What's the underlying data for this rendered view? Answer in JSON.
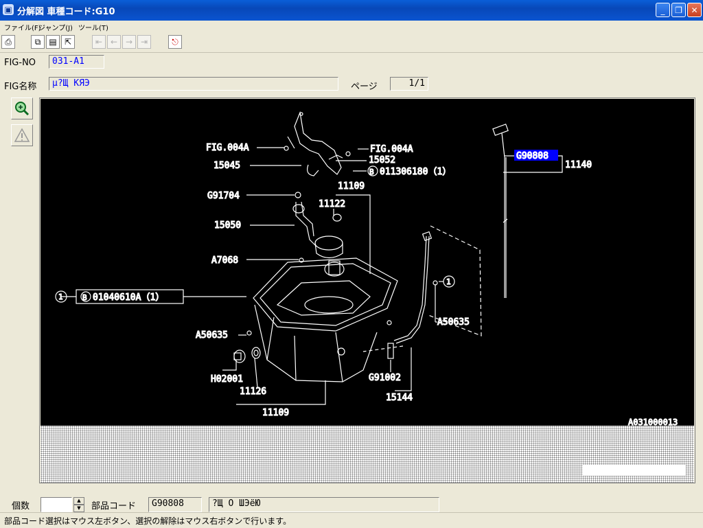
{
  "window": {
    "title": "分解図 車種コード:G10",
    "app_icon": "car-icon",
    "minimize": "_",
    "maximize": "❐",
    "close": "✕"
  },
  "menu": {
    "items": [
      "ファイル(F)",
      "ジャンプ(J)",
      "ツール(T)"
    ]
  },
  "toolbar": {
    "buttons": [
      "print-icon",
      "copy-icon",
      "window-icon",
      "export-icon",
      "first-icon",
      "prev-icon",
      "next-icon",
      "last-icon",
      "exit-icon"
    ]
  },
  "fig": {
    "no_label": "FIG-NO",
    "no_value": "031-A1",
    "name_label": "FIG名称",
    "name_value": "µ?Щ КЯЭ",
    "page_label": "ページ",
    "page_value": "1/1"
  },
  "side_tools": {
    "zoom": "zoom-icon",
    "warning": "warning-icon"
  },
  "diagram": {
    "id": "A031000013",
    "labels": {
      "fig004a_left": "FIG.004A",
      "fig004a_right": "FIG.004A",
      "p15052": "15052",
      "p15045": "15045",
      "p011306180": "011306180（1）",
      "p11109_top": "11109",
      "p11122": "11122",
      "pG91704": "G91704",
      "p15050": "15050",
      "pA7068": "A7068",
      "p01040610A": "01040610A（1）",
      "pA50635_right": "A50635",
      "pA50635_left": "A50635",
      "pH02001": "H02001",
      "p11126": "11126",
      "p11109_bottom": "11109",
      "pG91002": "G91002",
      "p15144": "15144",
      "pG90808": "G90808",
      "p11140": "11140",
      "circle_1": "1",
      "circle_b": "B"
    },
    "highlight_color": "#0000ff"
  },
  "bottom": {
    "qty_label": "個数",
    "qty_value": "",
    "part_code_label": "部品コード",
    "part_code_value": "G90808",
    "part_name_value": "?Щ О ШЭёЮ"
  },
  "status": {
    "text": "部品コード選択はマウス左ボタン、選択の解除はマウス右ボタンで行います。"
  }
}
